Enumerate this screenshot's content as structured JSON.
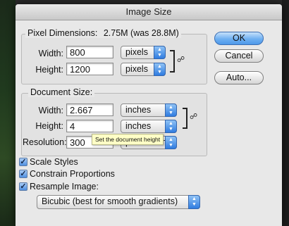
{
  "dialog": {
    "title": "Image Size"
  },
  "pixel_dimensions": {
    "legend": "Pixel Dimensions:",
    "size_text": "2.75M (was 28.8M)",
    "width_label": "Width:",
    "width_value": "800",
    "width_unit": "pixels",
    "height_label": "Height:",
    "height_value": "1200",
    "height_unit": "pixels"
  },
  "document_size": {
    "legend": "Document Size:",
    "width_label": "Width:",
    "width_value": "2.667",
    "width_unit": "inches",
    "height_label": "Height:",
    "height_value": "4",
    "height_unit": "inches",
    "resolution_label": "Resolution:",
    "resolution_value": "300",
    "resolution_unit": "pixels/inch"
  },
  "tooltip": "Set the document height",
  "buttons": {
    "ok": "OK",
    "cancel": "Cancel",
    "auto": "Auto..."
  },
  "options": {
    "scale_styles": {
      "label": "Scale Styles",
      "checked": true
    },
    "constrain_proportions": {
      "label": "Constrain Proportions",
      "checked": true
    },
    "resample_image": {
      "label": "Resample Image:",
      "checked": true
    },
    "resample_method": "Bicubic (best for smooth gradients)"
  },
  "icons": {
    "chain": "chain-link-icon",
    "select_arrows": "up-down-arrows-icon",
    "check": "checkmark-icon"
  },
  "colors": {
    "default_button": "#6fb0f1",
    "select_arrow": "#2f7ce0",
    "tooltip_bg": "#ffffc6"
  }
}
